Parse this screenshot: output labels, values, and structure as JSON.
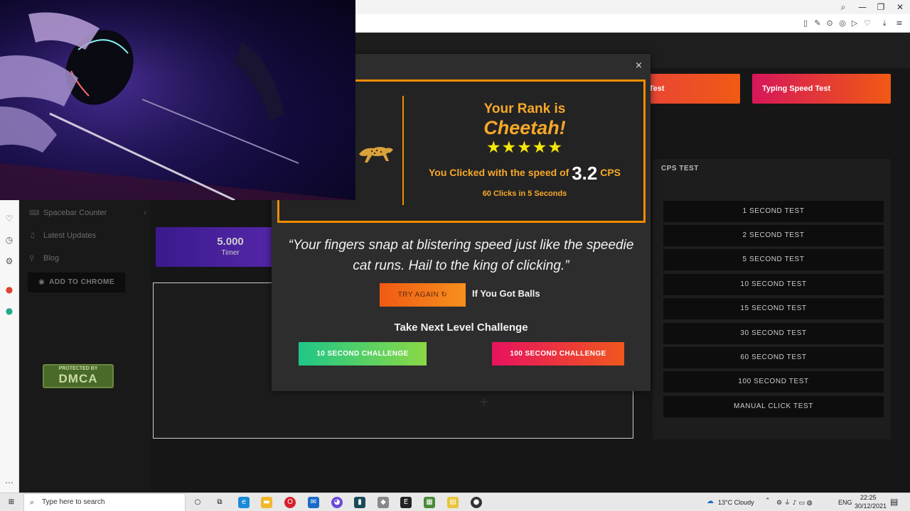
{
  "browser": {
    "window_controls": [
      "⌕",
      "—",
      "❐",
      "✕"
    ],
    "toolbar_icons": [
      "▯",
      "✎",
      "⊙",
      "◎",
      "▷",
      "♡",
      "⤓",
      "≡"
    ]
  },
  "nav": {
    "items": [
      {
        "label": "Spacebar Counter",
        "icon": "keyboard-icon"
      },
      {
        "label": "Latest Updates",
        "icon": "bell-icon"
      },
      {
        "label": "Blog",
        "icon": "pin-icon"
      }
    ],
    "chevron": "‹",
    "add_to_chrome": "ADD TO CHROME",
    "dmca_top": "PROTECTED BY",
    "dmca_bottom": "DMCA"
  },
  "header_buttons": [
    {
      "label": "d Test",
      "gradient": [
        "#e8423a",
        "#f05a14"
      ]
    },
    {
      "label": "Typing Speed Test",
      "gradient": [
        "#d6175a",
        "#f05a14"
      ]
    }
  ],
  "timer": {
    "value": "5.000",
    "label": "Timer"
  },
  "cps_panel": {
    "title": "CPS TEST",
    "tests": [
      "1 SECOND TEST",
      "2 SECOND TEST",
      "5 SECOND TEST",
      "10 SECOND TEST",
      "15 SECOND TEST",
      "30 SECOND TEST",
      "60 SECOND TEST",
      "100 SECOND TEST",
      "MANUAL CLICK TEST"
    ]
  },
  "modal": {
    "close": "×",
    "rank_label": "Your Rank is",
    "rank_name": "Cheetah!",
    "stars": "★★★★★",
    "speed_prefix": "You Clicked with the speed of",
    "speed_value": "3.2",
    "speed_unit": "CPS",
    "clicks_summary": "60 Clicks in 5 Seconds",
    "quote_line1": "“Your fingers snap at blistering speed just like the speedie",
    "quote_line2": "cat runs. Hail to the king of clicking.”",
    "try_again": "TRY AGAIN ↻",
    "try_again_suffix": "If You Got Balls",
    "next_level_title": "Take Next Level Challenge",
    "challenge_10": "10 SECOND CHALLENGE",
    "challenge_100": "100 SECOND CHALLENGE"
  },
  "taskbar": {
    "search_placeholder": "Type here to search",
    "weather": "13°C  Cloudy",
    "language": "ENG",
    "time": "22:25",
    "date": "30/12/2021"
  },
  "colors": {
    "accent_orange": "#f08c00",
    "star_yellow": "#f5e60a",
    "challenge_green": "#1fc787",
    "challenge_pink": "#e8125f"
  }
}
